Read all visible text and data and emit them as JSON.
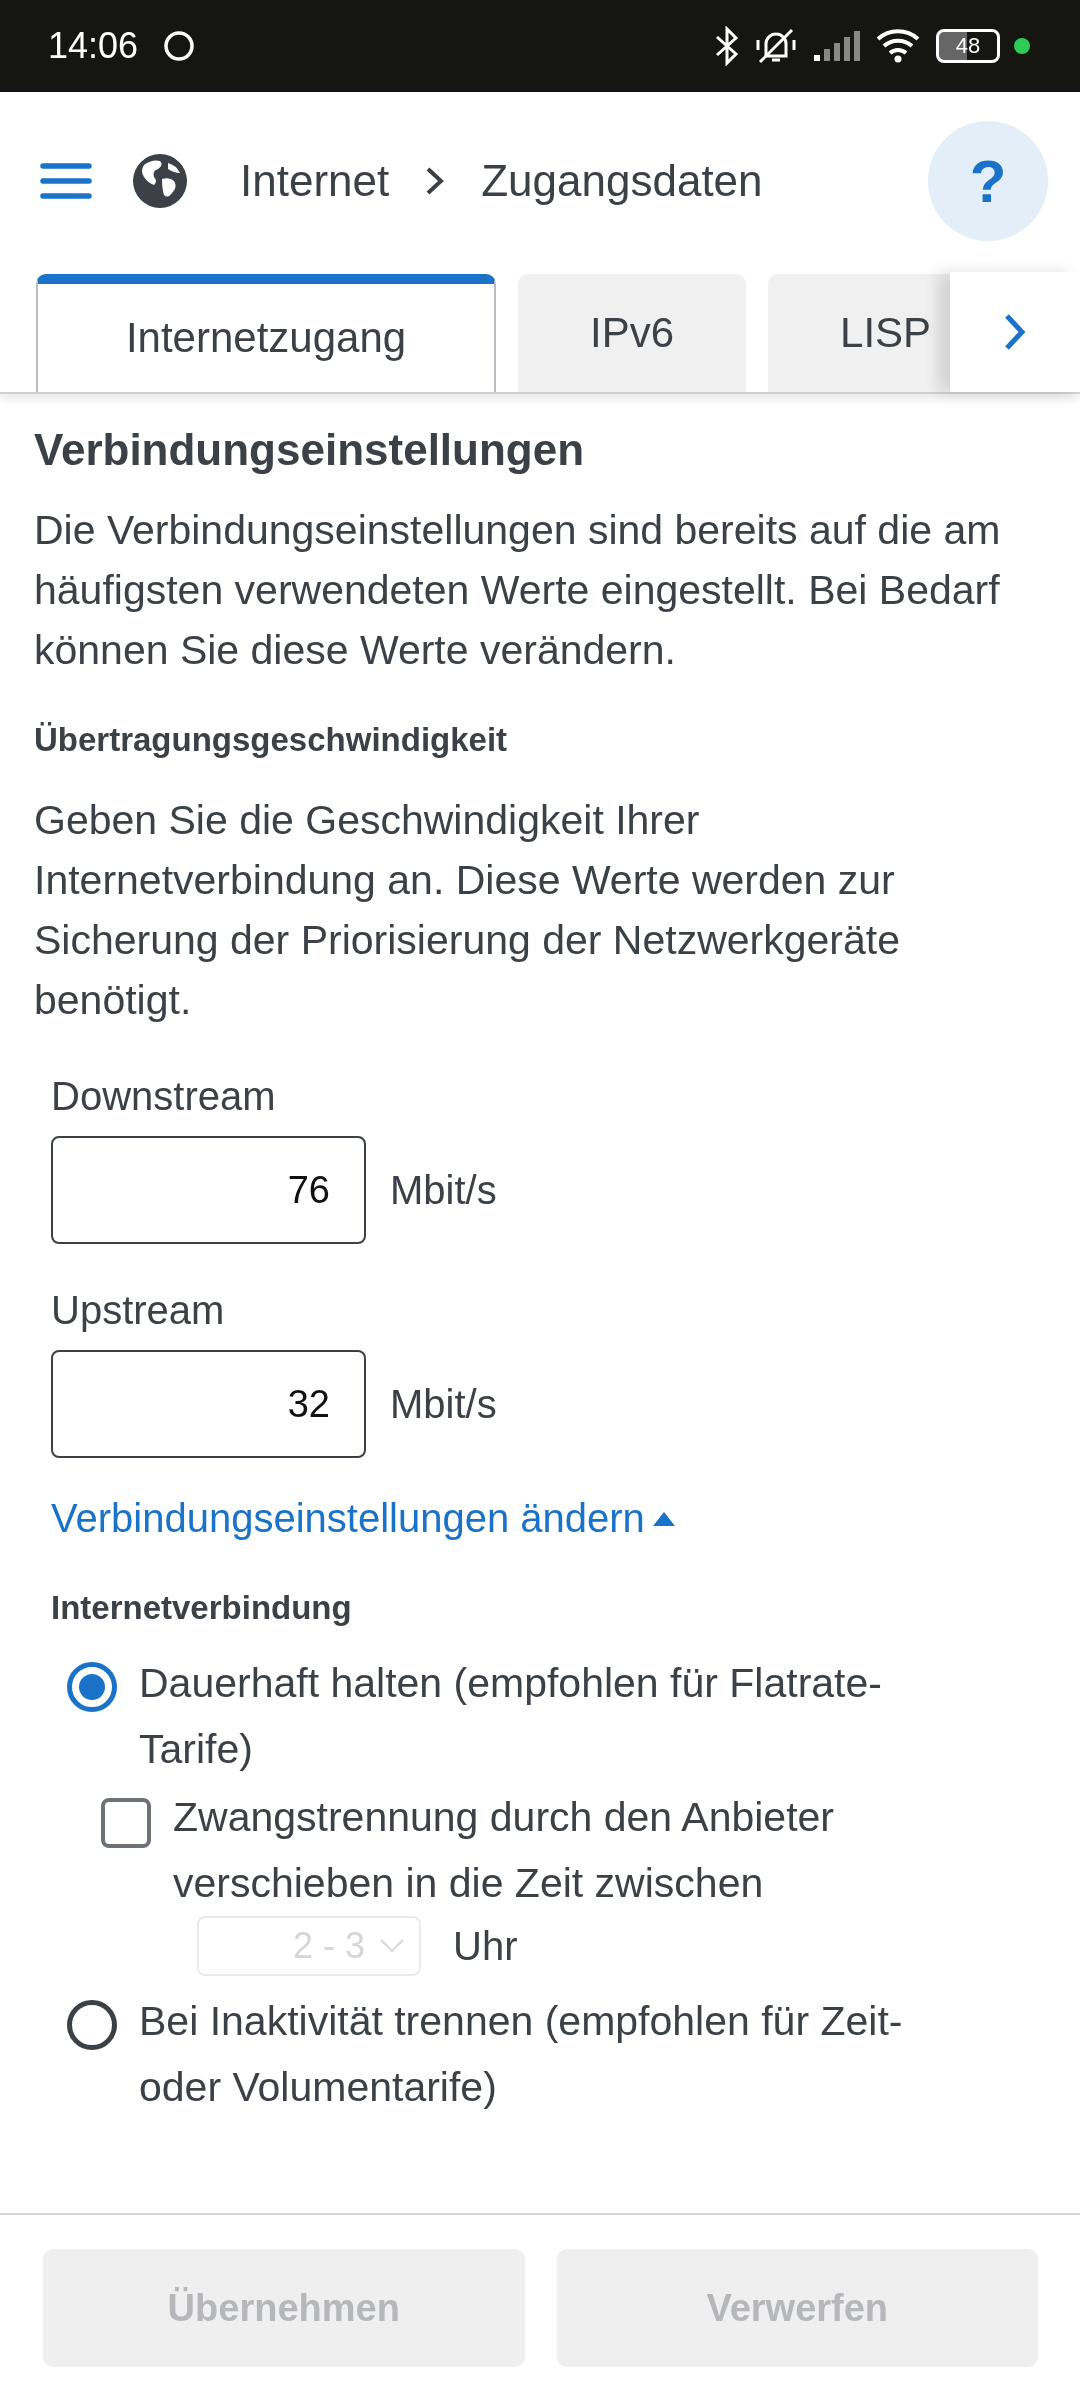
{
  "status_bar": {
    "time": "14:06",
    "battery": "48"
  },
  "header": {
    "breadcrumb": [
      "Internet",
      "Zugangsdaten"
    ],
    "help": "?"
  },
  "tabs": [
    {
      "label": "Internetzugang",
      "selected": true
    },
    {
      "label": "IPv6",
      "selected": false
    },
    {
      "label": "LISP",
      "selected": false
    }
  ],
  "section": {
    "title": "Verbindungseinstellungen",
    "intro": "Die Verbindungseinstellungen sind bereits auf die am häufigsten verwendeten Werte eingestellt. Bei Bedarf können Sie diese Werte verändern.",
    "subtitle": "Übertragungsgeschwindigkeit",
    "description": "Geben Sie die Geschwindigkeit Ihrer Internetverbindung an. Diese Werte werden zur Sicherung der Priorisierung der Netzwerkgeräte benötigt."
  },
  "speed_fields": [
    {
      "label": "Downstream",
      "value": "76",
      "unit": "Mbit/s"
    },
    {
      "label": "Upstream",
      "value": "32",
      "unit": "Mbit/s"
    }
  ],
  "toggle_link": {
    "label": "Verbindungseinstellungen ändern",
    "expanded": true
  },
  "connection": {
    "title": "Internetverbindung",
    "options": [
      {
        "label": "Dauerhaft halten (empfohlen für Flatrate-Tarife)",
        "selected": true,
        "sub": {
          "label": "Zwangstrennung durch den Anbieter verschieben in die Zeit zwischen",
          "checked": false,
          "select_value": "2 - 3",
          "select_disabled": true,
          "suffix": "Uhr"
        }
      },
      {
        "label": "Bei Inaktivität trennen (empfohlen für Zeit-oder Volumentarife)",
        "selected": false
      }
    ]
  },
  "footer_buttons": [
    {
      "label": "Übernehmen",
      "disabled": true
    },
    {
      "label": "Verwerfen",
      "disabled": true
    }
  ]
}
